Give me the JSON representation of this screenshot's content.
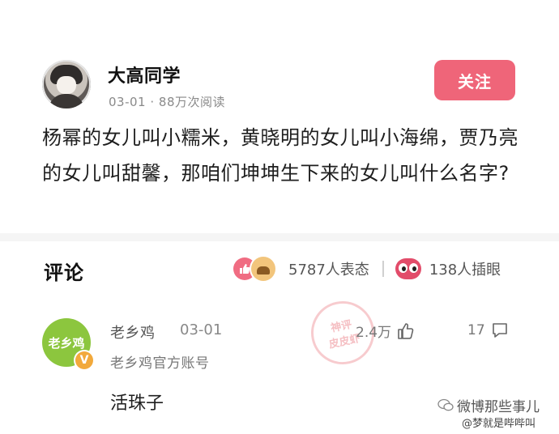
{
  "post": {
    "author": "大高同学",
    "date": "03-01",
    "views": "88万次阅读",
    "follow_label": "关注",
    "text": "杨幂的女儿叫小糯米，黄晓明的女儿叫小海绵，贾乃亮的女儿叫甜馨，那咱们坤坤生下来的女儿叫什么名字?"
  },
  "comments_section": {
    "title": "评论",
    "reactions_count": "5787人表态",
    "eye_count": "138人插眼"
  },
  "comment": {
    "avatar_text": "老乡鸡",
    "badge": "V",
    "author": "老乡鸡",
    "date": "03-01",
    "role": "老乡鸡官方账号",
    "text": "活珠子",
    "likes": "2.4万",
    "replies": "17"
  },
  "stamp": {
    "line1": "神评",
    "line2": "皮皮虾"
  },
  "watermark": {
    "line1": "微博那些事儿",
    "line2": "@梦就是哔哔叫"
  },
  "colors": {
    "accent": "#ef6579",
    "comment_avatar": "#8cc63e",
    "verified_badge": "#f2a93b"
  }
}
